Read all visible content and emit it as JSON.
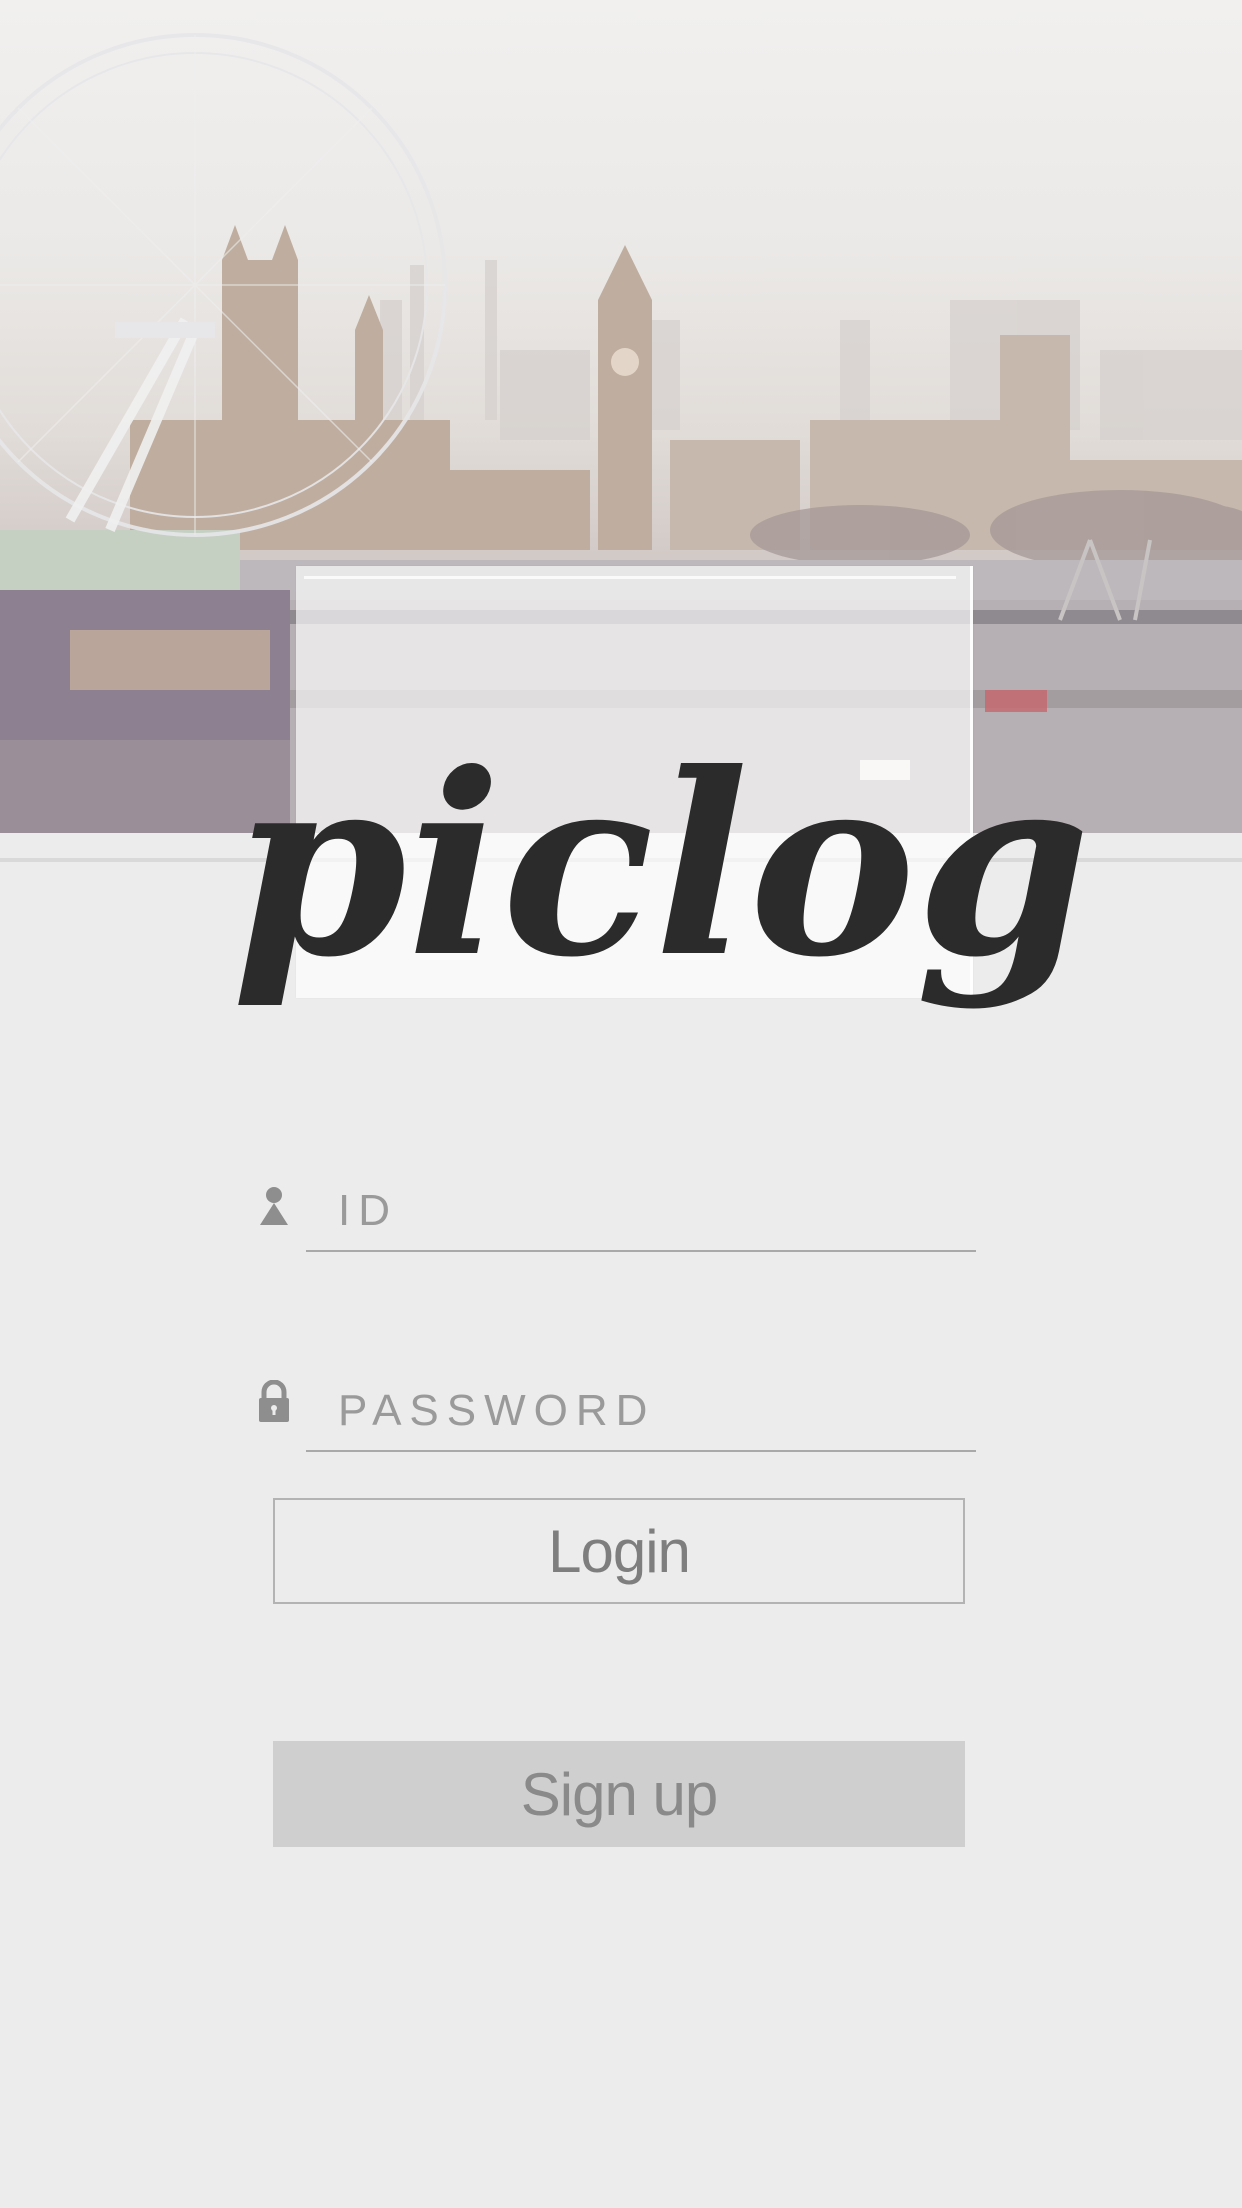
{
  "app": {
    "logo_text": "piclog"
  },
  "form": {
    "id_placeholder": "ID",
    "id_icon": "person-icon",
    "password_placeholder": "PASSWORD",
    "password_icon": "lock-icon",
    "login_label": "Login",
    "signup_label": "Sign up"
  },
  "colors": {
    "background": "#ececec",
    "logo": "#2b2b2b",
    "muted_text": "#9a9a9a",
    "signup_fill": "#cfcfcf"
  }
}
